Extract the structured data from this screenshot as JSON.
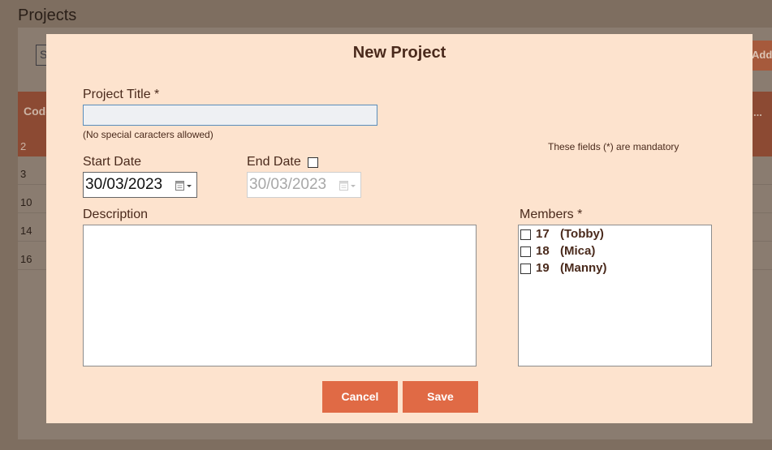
{
  "page": {
    "title": "Projects",
    "search_placeholder": "Search",
    "add_label": "Add",
    "table": {
      "header_code": "Code",
      "header_more": "...",
      "rows": [
        "2",
        "3",
        "10",
        "14",
        "16"
      ]
    }
  },
  "modal": {
    "title": "New Project",
    "project_title_label": "Project Title *",
    "project_title_value": "",
    "project_title_hint": "(No special caracters allowed)",
    "mandatory_note": "These fields (*) are mandatory",
    "start_date_label": "Start Date",
    "start_date_value": "30/03/2023",
    "end_date_label": "End Date",
    "end_date_value": "30/03/2023",
    "end_date_enabled": false,
    "description_label": "Description",
    "description_value": "",
    "members_label": "Members *",
    "members": [
      {
        "id": "17",
        "name": "(Tobby)",
        "checked": false
      },
      {
        "id": "18",
        "name": "(Mica)",
        "checked": false
      },
      {
        "id": "19",
        "name": "(Manny)",
        "checked": false
      }
    ],
    "cancel_label": "Cancel",
    "save_label": "Save"
  },
  "colors": {
    "overlay_background": "#7e6e60",
    "modal_background": "#fde3ce",
    "accent_button": "#e06a45",
    "table_header": "#8c4a33",
    "text": "#4a2a1c"
  },
  "icons": {
    "calendar": "calendar-icon",
    "checkbox": "checkbox-icon"
  }
}
